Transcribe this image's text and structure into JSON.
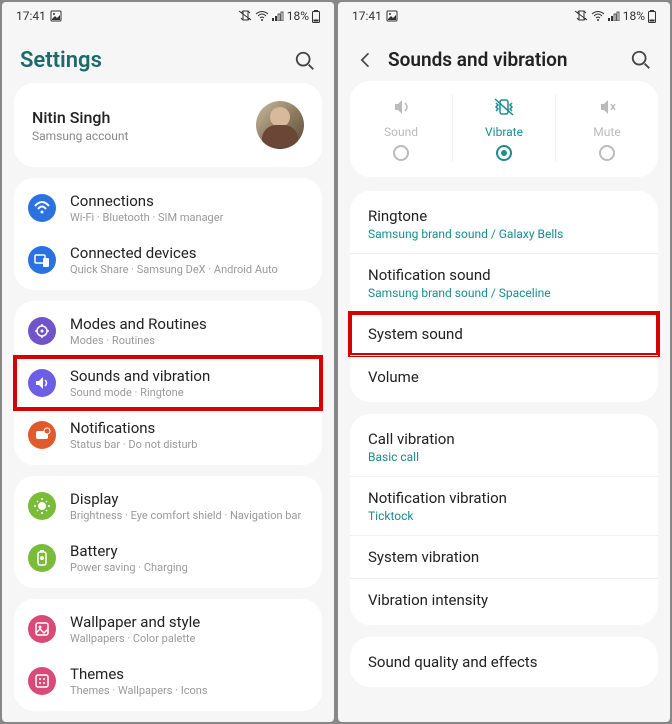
{
  "status": {
    "time": "17:41",
    "battery": "18%"
  },
  "left": {
    "title": "Settings",
    "profile": {
      "name": "Nitin Singh",
      "sub": "Samsung account"
    },
    "groups": [
      [
        {
          "icon": "wifi",
          "color": "#2b72e0",
          "title": "Connections",
          "sub": "Wi-Fi · Bluetooth · SIM manager"
        },
        {
          "icon": "devices",
          "color": "#2b72e0",
          "title": "Connected devices",
          "sub": "Quick Share · Samsung DeX · Android Auto"
        }
      ],
      [
        {
          "icon": "modes",
          "color": "#7254c9",
          "title": "Modes and Routines",
          "sub": "Modes · Routines"
        },
        {
          "icon": "sound",
          "color": "#6d5ee6",
          "title": "Sounds and vibration",
          "sub": "Sound mode · Ringtone",
          "highlight": true
        },
        {
          "icon": "notif",
          "color": "#e05a2b",
          "title": "Notifications",
          "sub": "Status bar · Do not disturb"
        }
      ],
      [
        {
          "icon": "display",
          "color": "#7bbb3a",
          "title": "Display",
          "sub": "Brightness · Eye comfort shield · Navigation bar"
        },
        {
          "icon": "battery",
          "color": "#7bbb3a",
          "title": "Battery",
          "sub": "Power saving · Charging"
        }
      ],
      [
        {
          "icon": "wallpaper",
          "color": "#d94a78",
          "title": "Wallpaper and style",
          "sub": "Wallpapers · Color palette"
        },
        {
          "icon": "themes",
          "color": "#d94a78",
          "title": "Themes",
          "sub": "Themes · Wallpapers · Icons"
        }
      ]
    ]
  },
  "right": {
    "title": "Sounds and vibration",
    "modes": [
      {
        "key": "sound",
        "label": "Sound",
        "active": false
      },
      {
        "key": "vibrate",
        "label": "Vibrate",
        "active": true
      },
      {
        "key": "mute",
        "label": "Mute",
        "active": false
      }
    ],
    "groups": [
      [
        {
          "title": "Ringtone",
          "sub": "Samsung brand sound / Galaxy Bells"
        },
        {
          "title": "Notification sound",
          "sub": "Samsung brand sound / Spaceline"
        },
        {
          "title": "System sound",
          "highlight": true
        },
        {
          "title": "Volume"
        }
      ],
      [
        {
          "title": "Call vibration",
          "sub": "Basic call"
        },
        {
          "title": "Notification vibration",
          "sub": "Ticktock"
        },
        {
          "title": "System vibration"
        },
        {
          "title": "Vibration intensity"
        }
      ],
      [
        {
          "title": "Sound quality and effects"
        }
      ]
    ]
  }
}
